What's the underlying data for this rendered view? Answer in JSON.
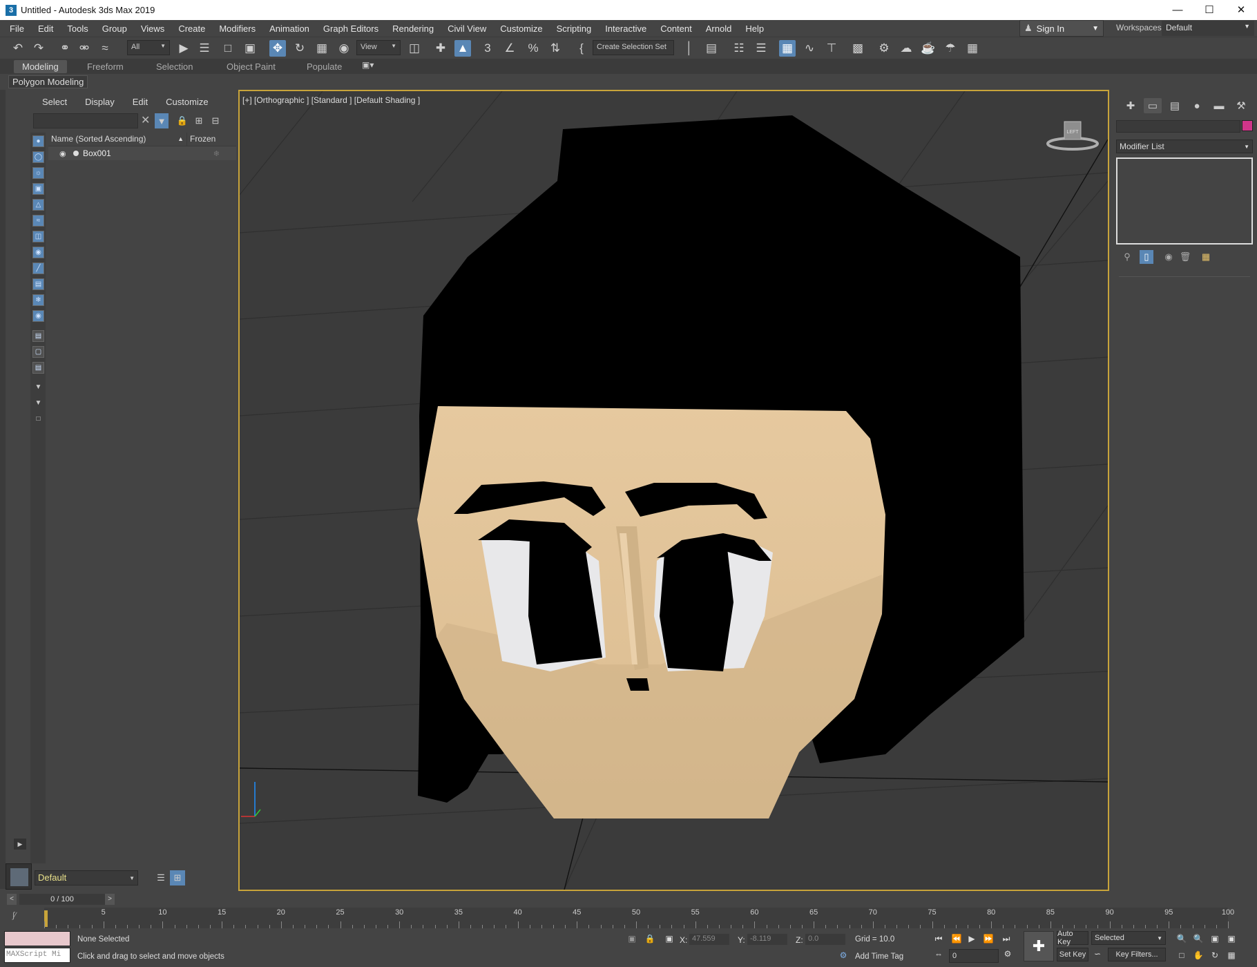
{
  "window": {
    "title": "Untitled - Autodesk 3ds Max 2019",
    "app_icon": "3"
  },
  "menu": [
    "File",
    "Edit",
    "Tools",
    "Group",
    "Views",
    "Create",
    "Modifiers",
    "Animation",
    "Graph Editors",
    "Rendering",
    "Civil View",
    "Customize",
    "Scripting",
    "Interactive",
    "Content",
    "Arnold",
    "Help"
  ],
  "account": {
    "sign_in": "Sign In",
    "workspaces_label": "Workspaces:",
    "workspace": "Default"
  },
  "toolbar": {
    "selection_filter": "All",
    "reference_coord": "View",
    "selection_set": "Create Selection Set"
  },
  "ribbon": {
    "tabs": [
      "Modeling",
      "Freeform",
      "Selection",
      "Object Paint",
      "Populate"
    ],
    "active": "Modeling",
    "sub_label": "Polygon Modeling"
  },
  "scene_explorer": {
    "menu": [
      "Select",
      "Display",
      "Edit",
      "Customize"
    ],
    "columns": {
      "name": "Name (Sorted Ascending)",
      "sort_indicator": "▲",
      "frozen": "Frozen"
    },
    "rows": [
      {
        "name": "Box001"
      }
    ],
    "layer": "Default"
  },
  "viewport": {
    "label": "[+] [Orthographic ] [Standard ] [Default Shading ]",
    "viewcube_face": "LEFT"
  },
  "command_panel": {
    "modifier_list": "Modifier List",
    "object_color": "#d0358a"
  },
  "time": {
    "slider_label": "0 / 100",
    "ruler_marks": [
      5,
      10,
      15,
      20,
      25,
      30,
      35,
      40,
      45,
      50,
      55,
      60,
      65,
      70,
      75,
      80,
      85,
      90,
      95,
      100
    ]
  },
  "status": {
    "selection": "None Selected",
    "prompt": "Click and drag to select and move objects",
    "maxscript_placeholder": "MAXScript Mi",
    "x_label": "X:",
    "x": "47.559",
    "y_label": "Y:",
    "y": "-8.119",
    "z_label": "Z:",
    "z": "0.0",
    "grid": "Grid = 10.0",
    "add_time_tag": "Add Time Tag",
    "auto_key": "Auto Key",
    "set_key": "Set Key",
    "key_mode": "Selected",
    "key_filters": "Key Filters...",
    "frame": "0"
  },
  "colors": {
    "accent": "#5a87b5",
    "viewport_border": "#c8a43a",
    "skin": "#e0c49c",
    "hair": "#000000"
  }
}
